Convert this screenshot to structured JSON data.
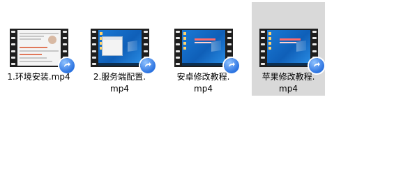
{
  "files": [
    {
      "name_line1": "1.环境安装.mp4",
      "name_line2": "",
      "selected": false,
      "icon": "video-file-icon",
      "badge_icon": "shortcut-arrow-icon"
    },
    {
      "name_line1": "2.服务端配置.",
      "name_line2": "mp4",
      "selected": false,
      "icon": "video-file-icon",
      "badge_icon": "shortcut-arrow-icon"
    },
    {
      "name_line1": "安卓修改教程.",
      "name_line2": "mp4",
      "selected": false,
      "icon": "video-file-icon",
      "badge_icon": "shortcut-arrow-icon"
    },
    {
      "name_line1": "苹果修改教程.",
      "name_line2": "mp4",
      "selected": true,
      "icon": "video-file-icon",
      "badge_icon": "shortcut-arrow-icon"
    }
  ],
  "colors": {
    "selection": "#d9d9d9",
    "film": "#1e1e1e",
    "desktop": "#1a7ad6",
    "badge": "#2c73e0"
  }
}
